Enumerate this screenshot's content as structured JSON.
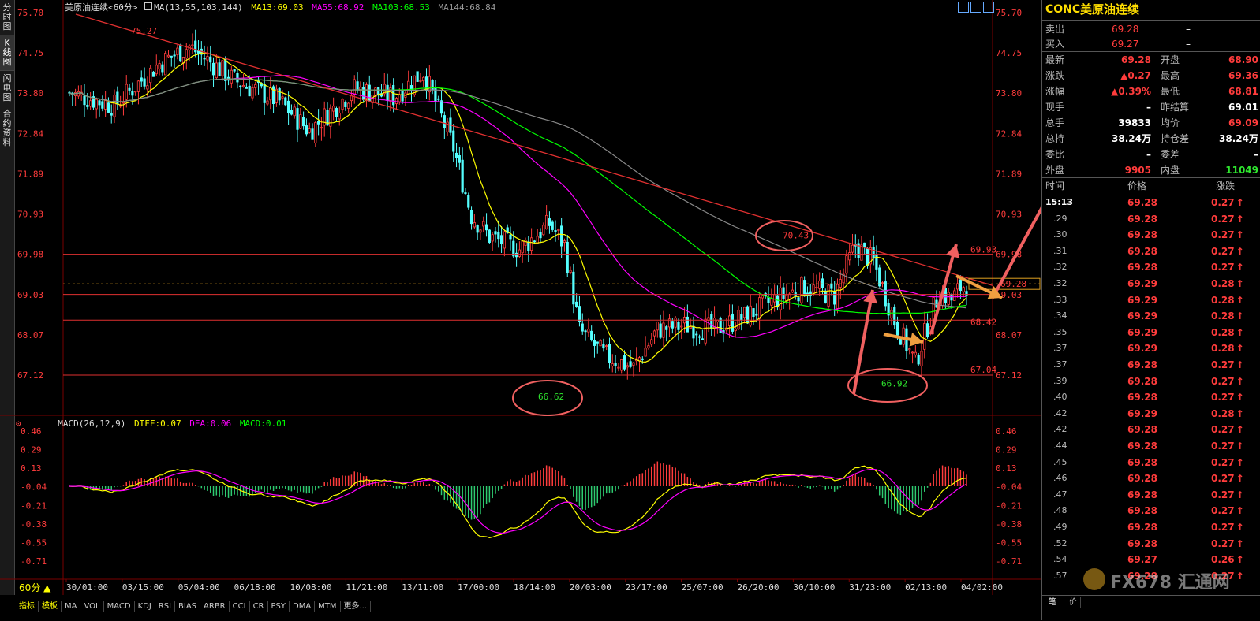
{
  "window": {
    "chart_title": "美原油连续",
    "period": "<60分>",
    "ma_label": "MA(13,55,103,144)",
    "ma13": "MA13:69.03",
    "ma55": "MA55:68.92",
    "ma103": "MA103:68.53",
    "ma144": "MA144:68.84",
    "period_button": "60分 ▲"
  },
  "left_tabs": [
    "分时图",
    "K线图",
    "闪电图",
    "合约资料"
  ],
  "price_axis": [
    "75.70",
    "74.75",
    "73.80",
    "72.84",
    "71.89",
    "70.93",
    "69.98",
    "69.03",
    "68.07",
    "67.12"
  ],
  "macd": {
    "label": "MACD(26,12,9)",
    "diff": "DIFF:0.07",
    "dea": "DEA:0.06",
    "macd": "MACD:0.01",
    "axis": [
      "0.46",
      "0.29",
      "0.13",
      "-0.04",
      "-0.21",
      "-0.38",
      "-0.55",
      "-0.71"
    ]
  },
  "x_labels": [
    "30/01:00",
    "03/15:00",
    "05/04:00",
    "06/18:00",
    "10/08:00",
    "11/21:00",
    "13/11:00",
    "17/00:00",
    "18/14:00",
    "20/03:00",
    "23/17:00",
    "25/07:00",
    "26/20:00",
    "30/10:00",
    "31/23:00",
    "02/13:00",
    "04/02:00"
  ],
  "annotations": {
    "high_1": "75.27",
    "low_1": "66.62",
    "high_2": "70.43",
    "low_2": "66.92",
    "level_69_93": "69.93",
    "level_68_42": "68.42",
    "level_67_04": "67.04",
    "current_price": "69.28"
  },
  "bottom_tabs": [
    "指标",
    "模板",
    "MA",
    "VOL",
    "MACD",
    "KDJ",
    "RSI",
    "BIAS",
    "ARBR",
    "CCI",
    "CR",
    "PSY",
    "DMA",
    "MTM",
    "更多..."
  ],
  "quote": {
    "code": "CONC",
    "name": "美原油连续",
    "sell_label": "卖出",
    "sell_price": "69.28",
    "sell_vol": "–",
    "buy_label": "买入",
    "buy_price": "69.27",
    "buy_vol": "–",
    "stats": [
      {
        "l1": "最新",
        "v1": "69.28",
        "l2": "开盘",
        "v2": "68.90"
      },
      {
        "l1": "涨跌",
        "v1": "0.27",
        "l2": "最高",
        "v2": "69.36"
      },
      {
        "l1": "涨幅",
        "v1": "0.39%",
        "l2": "最低",
        "v2": "68.81"
      },
      {
        "l1": "现手",
        "v1": "–",
        "l2": "昨结算",
        "v2": "69.01"
      },
      {
        "l1": "总手",
        "v1": "39833",
        "l2": "均价",
        "v2": "69.09"
      },
      {
        "l1": "总持",
        "v1": "38.24万",
        "l2": "持仓差",
        "v2": "38.24万"
      },
      {
        "l1": "委比",
        "v1": "–",
        "l2": "委差",
        "v2": "–"
      },
      {
        "l1": "外盘",
        "v1": "9905",
        "l2": "内盘",
        "v2": "11049"
      }
    ],
    "tick_headers": {
      "time": "时间",
      "price": "价格",
      "change": "涨跌"
    },
    "ticks": [
      {
        "t": "15:13",
        "p": "69.28",
        "c": "0.27"
      },
      {
        "t": ".29",
        "p": "69.28",
        "c": "0.27"
      },
      {
        "t": ".30",
        "p": "69.28",
        "c": "0.27"
      },
      {
        "t": ".31",
        "p": "69.28",
        "c": "0.27"
      },
      {
        "t": ".32",
        "p": "69.28",
        "c": "0.27"
      },
      {
        "t": ".32",
        "p": "69.29",
        "c": "0.28"
      },
      {
        "t": ".33",
        "p": "69.29",
        "c": "0.28"
      },
      {
        "t": ".34",
        "p": "69.29",
        "c": "0.28"
      },
      {
        "t": ".35",
        "p": "69.29",
        "c": "0.28"
      },
      {
        "t": ".37",
        "p": "69.29",
        "c": "0.28"
      },
      {
        "t": ".37",
        "p": "69.28",
        "c": "0.27"
      },
      {
        "t": ".39",
        "p": "69.28",
        "c": "0.27"
      },
      {
        "t": ".40",
        "p": "69.28",
        "c": "0.27"
      },
      {
        "t": ".42",
        "p": "69.29",
        "c": "0.28"
      },
      {
        "t": ".42",
        "p": "69.28",
        "c": "0.27"
      },
      {
        "t": ".44",
        "p": "69.28",
        "c": "0.27"
      },
      {
        "t": ".45",
        "p": "69.28",
        "c": "0.27"
      },
      {
        "t": ".46",
        "p": "69.28",
        "c": "0.27"
      },
      {
        "t": ".47",
        "p": "69.28",
        "c": "0.27"
      },
      {
        "t": ".48",
        "p": "69.28",
        "c": "0.27"
      },
      {
        "t": ".49",
        "p": "69.28",
        "c": "0.27"
      },
      {
        "t": ".52",
        "p": "69.28",
        "c": "0.27"
      },
      {
        "t": ".54",
        "p": "69.27",
        "c": "0.26"
      },
      {
        "t": ".57",
        "p": "69.28",
        "c": "0.27"
      }
    ],
    "bottom_tabs": [
      "笔",
      "价"
    ],
    "watermark": "FX678 汇通网"
  }
}
